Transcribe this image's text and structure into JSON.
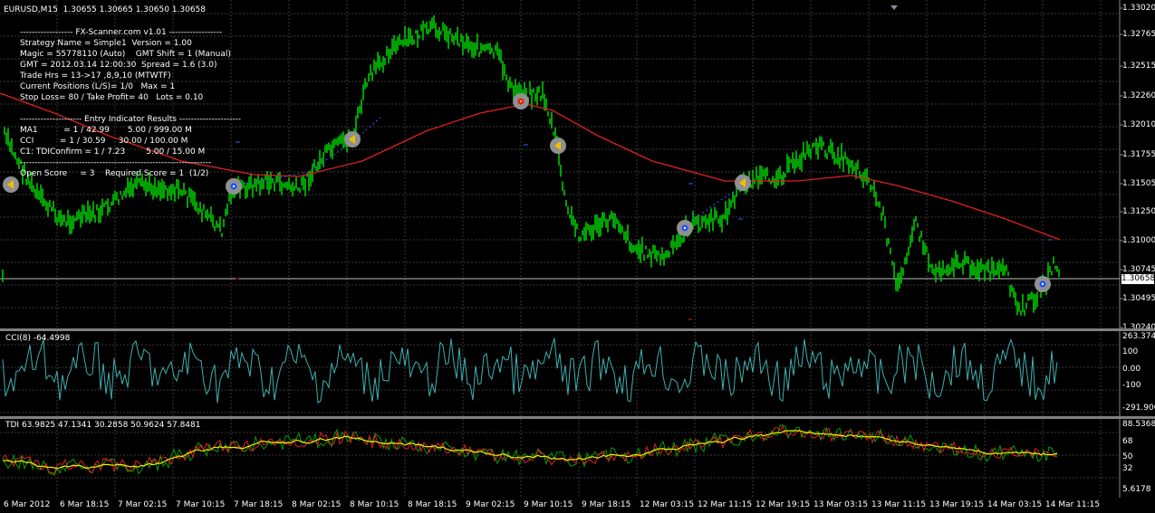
{
  "chart": {
    "symbol_header": "EURUSD,M15  1.30655 1.30665 1.30650 1.30658",
    "current_price": "1.30658",
    "price_ticks": [
      "1.33020",
      "1.32765",
      "1.32515",
      "1.32260",
      "1.32010",
      "1.31755",
      "1.31505",
      "1.31250",
      "1.31000",
      "1.30745",
      "1.30495",
      "1.30240"
    ],
    "colors": {
      "candles": "#00c800",
      "ma": "#e02020",
      "grid": "#3a3a3a",
      "cci": "#3fb0b0",
      "tdi_yellow": "#f0f000",
      "tdi_red": "#e02020",
      "tdi_green": "#00a000"
    }
  },
  "panel": {
    "lines": [
      "------------------ FX-Scanner.com v1.01 ------------------",
      "Strategy Name = Simple1  Version = 1.00",
      "Magic = 55778110 (Auto)    GMT Shift = 1 (Manual)",
      "GMT = 2012.03.14 12:00:30  Spread = 1.6 (3.0)",
      "Trade Hrs = 13->17 ,8,9,10 (MTWTF)",
      "Current Positions (L/S)= 1/0   Max = 1",
      "Stop Loss= 80 / Take Profit= 40   Lots = 0.10",
      "",
      "--------------------- Entry Indicator Results ---------------------",
      "MA1          = 1 / 42.99       5.00 / 999.00 M",
      "CCI          = 1 / 30.59     30.00 / 100.00 M",
      "C1: TDIConfirm = 1 / 7.23        5.00 / 15.00 M",
      "-----------------------------------------------------------------",
      "Open Score     = 3    Required Score = 1  (1/2)"
    ]
  },
  "cci": {
    "label": "CCI(8) -64.4998",
    "ticks": [
      "263.374",
      "100",
      "0.00",
      "-100",
      "-291.900"
    ]
  },
  "tdi": {
    "label": "TDI 63.9825 47.1341 30.2858 50.9624 57.8481",
    "ticks": [
      "88.5368",
      "68",
      "50",
      "32",
      "5.6178"
    ]
  },
  "xaxis": [
    "6 Mar 2012",
    "6 Mar 18:15",
    "7 Mar 02:15",
    "7 Mar 10:15",
    "7 Mar 18:15",
    "8 Mar 02:15",
    "8 Mar 10:15",
    "8 Mar 18:15",
    "9 Mar 02:15",
    "9 Mar 10:15",
    "9 Mar 18:15",
    "12 Mar 03:15",
    "12 Mar 11:15",
    "12 Mar 19:15",
    "13 Mar 03:15",
    "13 Mar 11:15",
    "13 Mar 19:15",
    "14 Mar 03:15",
    "14 Mar 11:15"
  ]
}
